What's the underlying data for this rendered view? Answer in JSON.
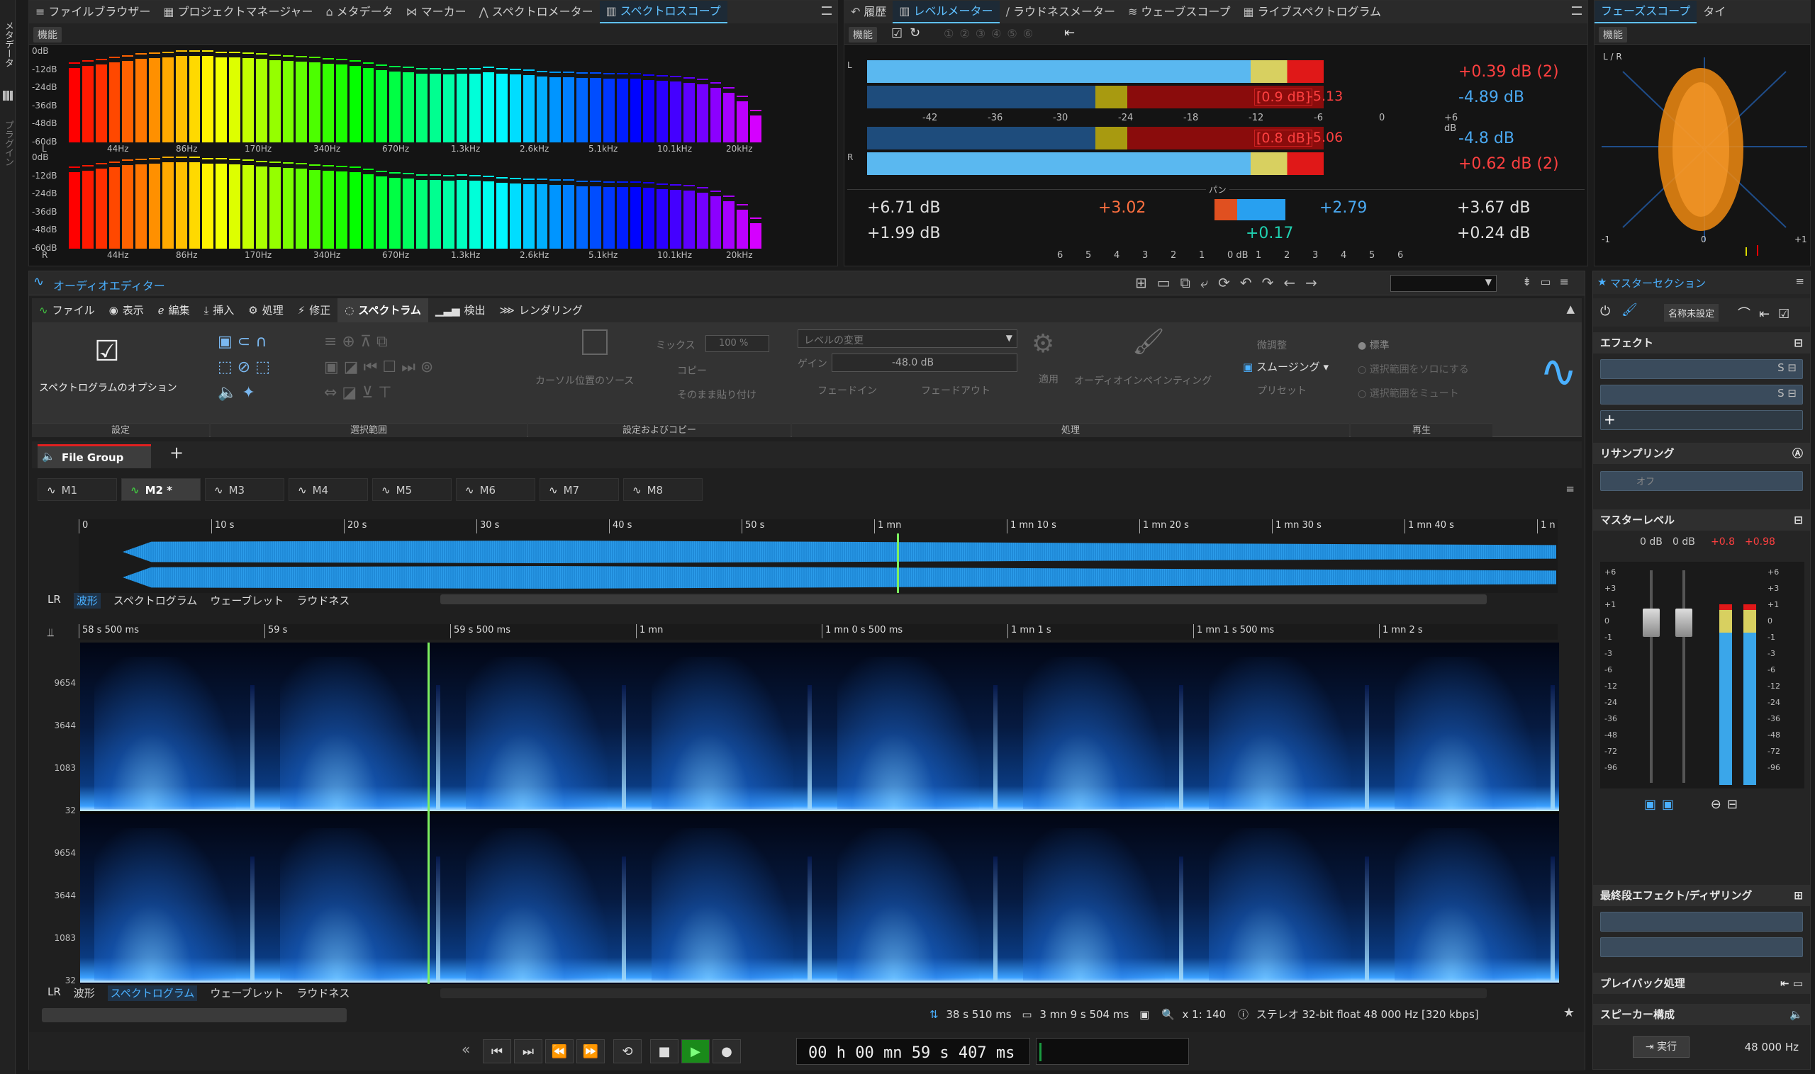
{
  "left_rail": {
    "items": [
      "メタデータ",
      "プラグイン"
    ]
  },
  "top_left_tabs": [
    {
      "label": "ファイルブラウザー",
      "icon": "list-icon"
    },
    {
      "label": "プロジェクトマネージャー",
      "icon": "grid-icon"
    },
    {
      "label": "メタデータ",
      "icon": "tag-icon"
    },
    {
      "label": "マーカー",
      "icon": "marker-icon"
    },
    {
      "label": "スペクトロメーター",
      "icon": "spectrometer-icon"
    },
    {
      "label": "スペクトロスコープ",
      "icon": "bars-icon",
      "active": true
    }
  ],
  "spectroscope": {
    "func_label": "機能",
    "db_labels": [
      "0dB",
      "-12dB",
      "-24dB",
      "-36dB",
      "-48dB",
      "-60dB"
    ],
    "freq_labels": [
      "44Hz",
      "86Hz",
      "170Hz",
      "340Hz",
      "670Hz",
      "1.3kHz",
      "2.6kHz",
      "5.1kHz",
      "10.1kHz",
      "20kHz"
    ],
    "channels": [
      "L",
      "R"
    ],
    "levels_L": [
      0.82,
      0.84,
      0.86,
      0.88,
      0.9,
      0.92,
      0.93,
      0.94,
      0.95,
      0.95,
      0.95,
      0.94,
      0.94,
      0.93,
      0.92,
      0.91,
      0.9,
      0.89,
      0.88,
      0.87,
      0.86,
      0.84,
      0.82,
      0.8,
      0.78,
      0.77,
      0.76,
      0.76,
      0.75,
      0.76,
      0.76,
      0.77,
      0.76,
      0.75,
      0.74,
      0.73,
      0.72,
      0.72,
      0.71,
      0.71,
      0.7,
      0.7,
      0.7,
      0.69,
      0.68,
      0.67,
      0.66,
      0.64,
      0.6,
      0.55,
      0.45,
      0.3
    ],
    "levels_R": [
      0.84,
      0.86,
      0.88,
      0.9,
      0.92,
      0.93,
      0.94,
      0.95,
      0.95,
      0.95,
      0.94,
      0.94,
      0.93,
      0.92,
      0.91,
      0.9,
      0.89,
      0.88,
      0.87,
      0.86,
      0.85,
      0.84,
      0.82,
      0.8,
      0.78,
      0.77,
      0.76,
      0.76,
      0.75,
      0.76,
      0.75,
      0.74,
      0.73,
      0.72,
      0.71,
      0.71,
      0.7,
      0.7,
      0.69,
      0.69,
      0.68,
      0.68,
      0.68,
      0.67,
      0.66,
      0.65,
      0.64,
      0.62,
      0.58,
      0.52,
      0.43,
      0.28
    ]
  },
  "level_meter_tabs": [
    {
      "label": "履歴",
      "icon": "undo-icon"
    },
    {
      "label": "レベルメーター",
      "icon": "bars-icon",
      "active": true
    },
    {
      "label": "ラウドネスメーター",
      "icon": "needle-icon"
    },
    {
      "label": "ウェーブスコープ",
      "icon": "wave-icon"
    },
    {
      "label": "ライブスペクトログラム",
      "icon": "grid-icon"
    }
  ],
  "level_meter": {
    "func_label": "機能",
    "scale": [
      "-42",
      "-36",
      "-30",
      "-24",
      "-18",
      "-12",
      "-6",
      "0",
      "+6 dB"
    ],
    "L": {
      "peak": "+0.39 dB (2)",
      "rms": "-4.89 dB",
      "box": "[0.9 dB]",
      "val": "-5.13"
    },
    "R": {
      "peak": "+0.62 dB (2)",
      "rms": "-4.8 dB",
      "box": "[0.8 dB]",
      "val": "-5.06"
    },
    "pan_label": "パン",
    "pan_values": {
      "a": "+6.71 dB",
      "b": "+1.99 dB",
      "c": "+3.02",
      "d": "+2.79",
      "e": "+0.17",
      "f": "+3.67 dB",
      "g": "+0.24 dB"
    },
    "pan_scale": [
      "6",
      "5",
      "4",
      "3",
      "2",
      "1",
      "0 dB",
      "1",
      "2",
      "3",
      "4",
      "5",
      "6"
    ]
  },
  "phase_tabs": [
    {
      "label": "フェーズスコープ",
      "active": true
    },
    {
      "label": "タイ"
    }
  ],
  "phase": {
    "func_label": "機能",
    "lr_label": "L / R",
    "axis": [
      "-1",
      "0",
      "+1"
    ]
  },
  "editor": {
    "title": "オーディオエディター",
    "ribbon_tabs": [
      {
        "label": "ファイル",
        "icon": "wave-logo-icon"
      },
      {
        "label": "表示",
        "icon": "eye-icon"
      },
      {
        "label": "編集",
        "icon": "edit-icon"
      },
      {
        "label": "挿入",
        "icon": "insert-icon"
      },
      {
        "label": "処理",
        "icon": "gear-icon"
      },
      {
        "label": "修正",
        "icon": "bolt-icon"
      },
      {
        "label": "スペクトラム",
        "icon": "spectrum-icon",
        "active": true
      },
      {
        "label": "検出",
        "icon": "detect-icon"
      },
      {
        "label": "レンダリング",
        "icon": "render-icon"
      }
    ],
    "ribbon": {
      "spectro_options": "スペクトログラムのオプション",
      "group_settings": "設定",
      "group_range": "選択範囲",
      "group_copy": "設定およびコピー",
      "group_process": "処理",
      "group_play": "再生",
      "mix_label": "ミックス",
      "mix_value": "100 %",
      "copy": "コピー",
      "paste": "そのまま貼り付け",
      "cursor_source": "カーソル位置のソース",
      "level_change": "レベルの変更",
      "gain_label": "ゲイン",
      "gain_value": "-48.0 dB",
      "fade_in": "フェードイン",
      "fade_out": "フェードアウト",
      "apply": "適用",
      "inpainting": "オーディオインペインティング",
      "fine_tune": "微調整",
      "smoothing": "スムージング",
      "preset": "プリセット",
      "standard": "標準",
      "solo_sel": "選択範囲をソロにする",
      "mute_sel": "選択範囲をミュート"
    },
    "file_group": "File Group",
    "markers": [
      "M1",
      "M2 *",
      "M3",
      "M4",
      "M5",
      "M6",
      "M7",
      "M8"
    ],
    "overview_ruler": [
      "0",
      "10 s",
      "20 s",
      "30 s",
      "40 s",
      "50 s",
      "1 mn",
      "1 mn 10 s",
      "1 mn 20 s",
      "1 mn 30 s",
      "1 mn 40 s",
      "1 n"
    ],
    "view_tabs": [
      "LR",
      "波形",
      "スペクトログラム",
      "ウェーブレット",
      "ラウドネス"
    ],
    "detail_ruler": [
      "58 s 500 ms",
      "59 s",
      "59 s 500 ms",
      "1 mn",
      "1 mn 0 s 500 ms",
      "1 mn 1 s",
      "1 mn 1 s 500 ms",
      "1 mn 2 s"
    ],
    "freq_axis": [
      "9654",
      "3644",
      "1083",
      "32"
    ],
    "status": {
      "position": "38 s 510 ms",
      "length": "3 mn 9 s 504 ms",
      "zoom": "x 1: 140",
      "format": "ステレオ 32-bit float 48 000 Hz [320 kbps]"
    }
  },
  "transport": {
    "time": "00 h 00 mn 59 s 407 ms"
  },
  "master": {
    "title": "マスターセクション",
    "preset": "名称未設定",
    "effects": "エフェクト",
    "resampling": "リサンプリング",
    "resampling_value": "オフ",
    "master_level": "マスターレベル",
    "level_readouts": [
      "0 dB",
      "0 dB",
      "+0.8",
      "+0.98"
    ],
    "fader_scale": [
      "+6",
      "+3",
      "+1",
      "0",
      "-1",
      "-3",
      "-6",
      "-12",
      "-24",
      "-36",
      "-48",
      "-72",
      "-96"
    ],
    "final_effects": "最終段エフェクト/ディザリング",
    "playback": "プレイバック処理",
    "speaker": "スピーカー構成",
    "run": "実行",
    "sample_rate": "48 000 Hz"
  }
}
